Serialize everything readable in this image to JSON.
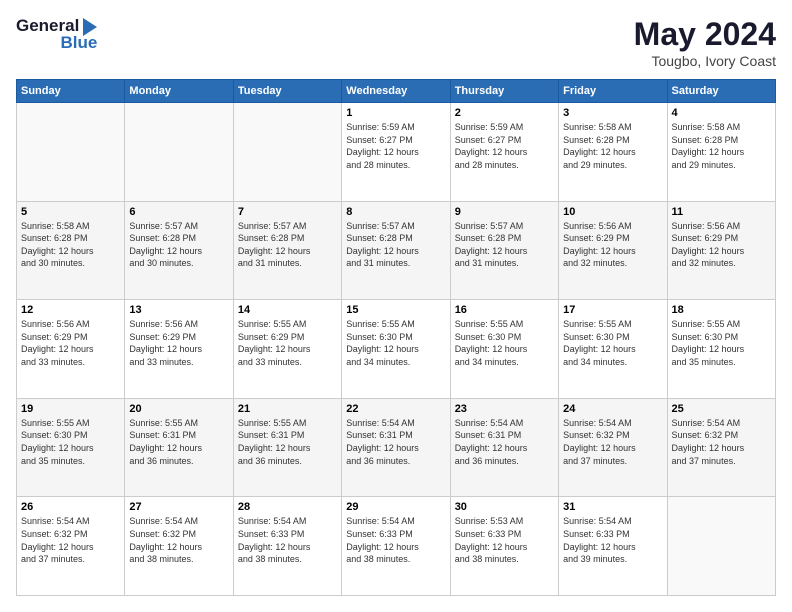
{
  "header": {
    "logo_line1": "General",
    "logo_line2": "Blue",
    "month": "May 2024",
    "location": "Tougbo, Ivory Coast"
  },
  "weekdays": [
    "Sunday",
    "Monday",
    "Tuesday",
    "Wednesday",
    "Thursday",
    "Friday",
    "Saturday"
  ],
  "weeks": [
    [
      {
        "day": "",
        "info": ""
      },
      {
        "day": "",
        "info": ""
      },
      {
        "day": "",
        "info": ""
      },
      {
        "day": "1",
        "info": "Sunrise: 5:59 AM\nSunset: 6:27 PM\nDaylight: 12 hours\nand 28 minutes."
      },
      {
        "day": "2",
        "info": "Sunrise: 5:59 AM\nSunset: 6:27 PM\nDaylight: 12 hours\nand 28 minutes."
      },
      {
        "day": "3",
        "info": "Sunrise: 5:58 AM\nSunset: 6:28 PM\nDaylight: 12 hours\nand 29 minutes."
      },
      {
        "day": "4",
        "info": "Sunrise: 5:58 AM\nSunset: 6:28 PM\nDaylight: 12 hours\nand 29 minutes."
      }
    ],
    [
      {
        "day": "5",
        "info": "Sunrise: 5:58 AM\nSunset: 6:28 PM\nDaylight: 12 hours\nand 30 minutes."
      },
      {
        "day": "6",
        "info": "Sunrise: 5:57 AM\nSunset: 6:28 PM\nDaylight: 12 hours\nand 30 minutes."
      },
      {
        "day": "7",
        "info": "Sunrise: 5:57 AM\nSunset: 6:28 PM\nDaylight: 12 hours\nand 31 minutes."
      },
      {
        "day": "8",
        "info": "Sunrise: 5:57 AM\nSunset: 6:28 PM\nDaylight: 12 hours\nand 31 minutes."
      },
      {
        "day": "9",
        "info": "Sunrise: 5:57 AM\nSunset: 6:28 PM\nDaylight: 12 hours\nand 31 minutes."
      },
      {
        "day": "10",
        "info": "Sunrise: 5:56 AM\nSunset: 6:29 PM\nDaylight: 12 hours\nand 32 minutes."
      },
      {
        "day": "11",
        "info": "Sunrise: 5:56 AM\nSunset: 6:29 PM\nDaylight: 12 hours\nand 32 minutes."
      }
    ],
    [
      {
        "day": "12",
        "info": "Sunrise: 5:56 AM\nSunset: 6:29 PM\nDaylight: 12 hours\nand 33 minutes."
      },
      {
        "day": "13",
        "info": "Sunrise: 5:56 AM\nSunset: 6:29 PM\nDaylight: 12 hours\nand 33 minutes."
      },
      {
        "day": "14",
        "info": "Sunrise: 5:55 AM\nSunset: 6:29 PM\nDaylight: 12 hours\nand 33 minutes."
      },
      {
        "day": "15",
        "info": "Sunrise: 5:55 AM\nSunset: 6:30 PM\nDaylight: 12 hours\nand 34 minutes."
      },
      {
        "day": "16",
        "info": "Sunrise: 5:55 AM\nSunset: 6:30 PM\nDaylight: 12 hours\nand 34 minutes."
      },
      {
        "day": "17",
        "info": "Sunrise: 5:55 AM\nSunset: 6:30 PM\nDaylight: 12 hours\nand 34 minutes."
      },
      {
        "day": "18",
        "info": "Sunrise: 5:55 AM\nSunset: 6:30 PM\nDaylight: 12 hours\nand 35 minutes."
      }
    ],
    [
      {
        "day": "19",
        "info": "Sunrise: 5:55 AM\nSunset: 6:30 PM\nDaylight: 12 hours\nand 35 minutes."
      },
      {
        "day": "20",
        "info": "Sunrise: 5:55 AM\nSunset: 6:31 PM\nDaylight: 12 hours\nand 36 minutes."
      },
      {
        "day": "21",
        "info": "Sunrise: 5:55 AM\nSunset: 6:31 PM\nDaylight: 12 hours\nand 36 minutes."
      },
      {
        "day": "22",
        "info": "Sunrise: 5:54 AM\nSunset: 6:31 PM\nDaylight: 12 hours\nand 36 minutes."
      },
      {
        "day": "23",
        "info": "Sunrise: 5:54 AM\nSunset: 6:31 PM\nDaylight: 12 hours\nand 36 minutes."
      },
      {
        "day": "24",
        "info": "Sunrise: 5:54 AM\nSunset: 6:32 PM\nDaylight: 12 hours\nand 37 minutes."
      },
      {
        "day": "25",
        "info": "Sunrise: 5:54 AM\nSunset: 6:32 PM\nDaylight: 12 hours\nand 37 minutes."
      }
    ],
    [
      {
        "day": "26",
        "info": "Sunrise: 5:54 AM\nSunset: 6:32 PM\nDaylight: 12 hours\nand 37 minutes."
      },
      {
        "day": "27",
        "info": "Sunrise: 5:54 AM\nSunset: 6:32 PM\nDaylight: 12 hours\nand 38 minutes."
      },
      {
        "day": "28",
        "info": "Sunrise: 5:54 AM\nSunset: 6:33 PM\nDaylight: 12 hours\nand 38 minutes."
      },
      {
        "day": "29",
        "info": "Sunrise: 5:54 AM\nSunset: 6:33 PM\nDaylight: 12 hours\nand 38 minutes."
      },
      {
        "day": "30",
        "info": "Sunrise: 5:53 AM\nSunset: 6:33 PM\nDaylight: 12 hours\nand 38 minutes."
      },
      {
        "day": "31",
        "info": "Sunrise: 5:54 AM\nSunset: 6:33 PM\nDaylight: 12 hours\nand 39 minutes."
      },
      {
        "day": "",
        "info": ""
      }
    ]
  ]
}
